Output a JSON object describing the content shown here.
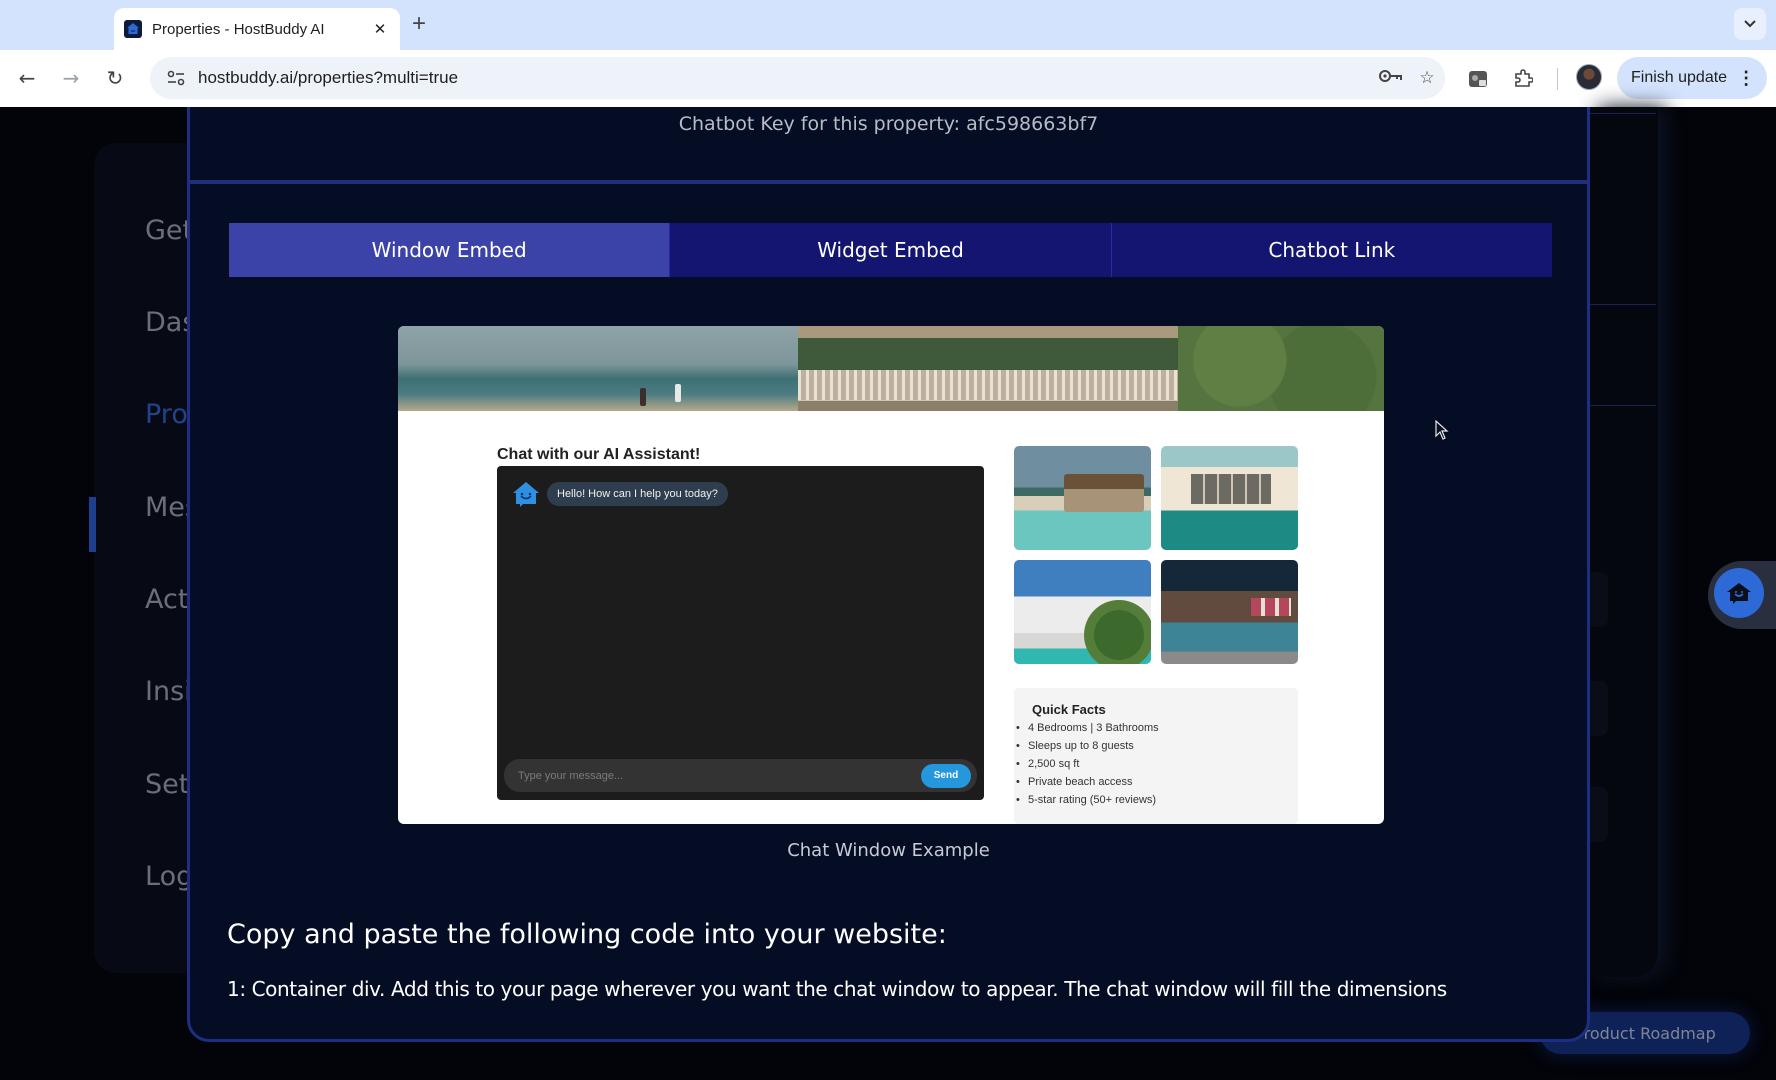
{
  "browser": {
    "tab": {
      "title": "Properties - HostBuddy AI",
      "favicon": "hostbuddy-house-icon",
      "close_glyph": "✕"
    },
    "new_tab_glyph": "+",
    "tab_menu_glyph": "⌄",
    "nav": {
      "back_glyph": "←",
      "forward_glyph": "→",
      "reload_glyph": "↻"
    },
    "url": "hostbuddy.ai/properties?multi=true",
    "omnibox_icons": [
      "key-icon",
      "star-icon"
    ],
    "toolbar_icons": [
      "extension-app-icon",
      "puzzle-extensions-icon",
      "profile-avatar"
    ],
    "finish_update_label": "Finish update",
    "menu_glyph": "⋮"
  },
  "sidebar": {
    "items": [
      {
        "label": "Get Started",
        "visible": "Get",
        "active": false
      },
      {
        "label": "Dashboard",
        "visible": "Das",
        "active": false
      },
      {
        "label": "Properties",
        "visible": "Pro",
        "active": true
      },
      {
        "label": "Messages",
        "visible": "Mes",
        "active": false
      },
      {
        "label": "Action Items",
        "visible": "Act",
        "active": false
      },
      {
        "label": "Insights",
        "visible": "Insi",
        "active": false
      },
      {
        "label": "Settings",
        "visible": "Set",
        "active": false
      },
      {
        "label": "Logout",
        "visible": "Log",
        "active": false
      }
    ]
  },
  "floating": {
    "chat_button_icon": "hostbuddy-chat-icon",
    "roadmap_label": "Product Roadmap"
  },
  "modal": {
    "chatbot_key_text": "Chatbot Key for this property: afc598663bf7",
    "tabs": [
      {
        "label": "Window Embed",
        "active": true
      },
      {
        "label": "Widget Embed",
        "active": false
      },
      {
        "label": "Chatbot Link",
        "active": false
      }
    ],
    "preview": {
      "chat_title": "Chat with our AI Assistant!",
      "bot_greeting": "Hello! How can I help you today?",
      "input_placeholder": "Type your message...",
      "send_label": "Send",
      "photos": [
        "beach-bungalow-photo",
        "poolside-villa-photo",
        "modern-white-villa-photo",
        "night-pool-courtyard-photo"
      ],
      "quick_facts": {
        "title": "Quick Facts",
        "items": [
          "4 Bedrooms | 3 Bathrooms",
          "Sleeps up to 8 guests",
          "2,500 sq ft",
          "Private beach access",
          "5-star rating (50+ reviews)"
        ]
      }
    },
    "caption": "Chat Window Example",
    "copy_heading": "Copy and paste the following code into your website:",
    "step1_text": "1: Container div. Add this to your page wherever you want the chat window to appear. The chat window will fill the dimensions"
  },
  "colors": {
    "modal_bg": "#050d25",
    "modal_border": "#1d2e85",
    "tab_active": "#3c43a8",
    "tab_inactive": "#131570",
    "send_button": "#2597dd",
    "float_button": "#2d6ad7"
  }
}
